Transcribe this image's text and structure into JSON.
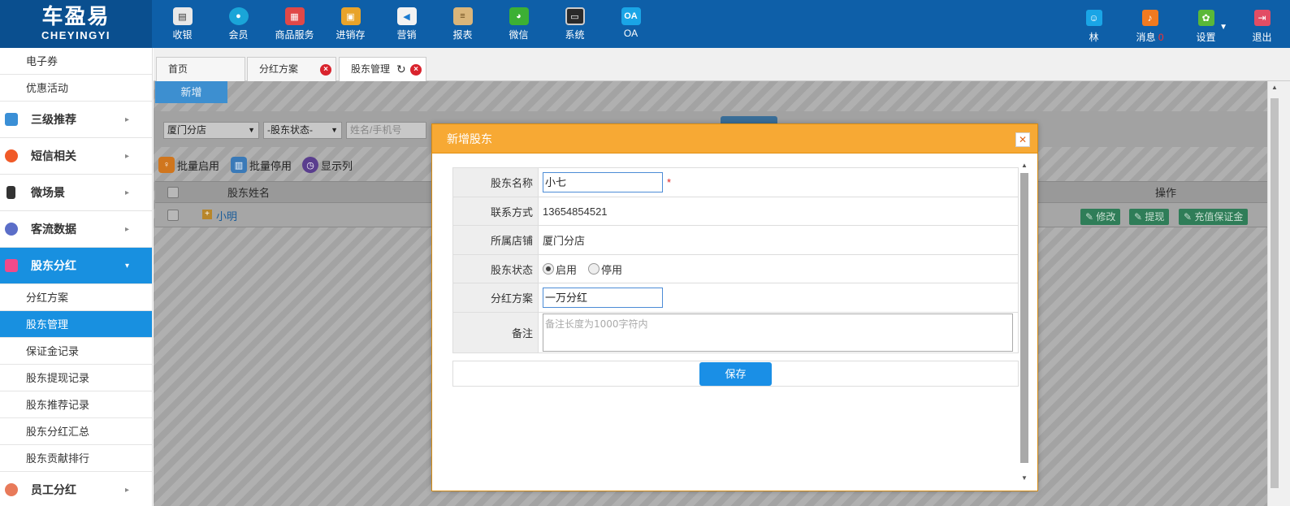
{
  "logo": {
    "cn": "车盈易",
    "en": "CHEYINGYI"
  },
  "nav": [
    {
      "label": "收银",
      "icon": "cash-register-icon",
      "color": "#e8e8e8"
    },
    {
      "label": "会员",
      "icon": "member-icon",
      "color": "#1aa5d8"
    },
    {
      "label": "商品服务",
      "icon": "goods-icon",
      "color": "#e04848"
    },
    {
      "label": "进销存",
      "icon": "inventory-icon",
      "color": "#e8a32a"
    },
    {
      "label": "营销",
      "icon": "megaphone-icon",
      "color": "#f2f2f2"
    },
    {
      "label": "报表",
      "icon": "report-icon",
      "color": "#d9b57a"
    },
    {
      "label": "微信",
      "icon": "wechat-icon",
      "color": "#3cb034"
    },
    {
      "label": "系统",
      "icon": "monitor-icon",
      "color": "#2a2a2a"
    },
    {
      "label": "OA",
      "icon": "oa-icon",
      "color": "#1aa5e6"
    }
  ],
  "right_nav": {
    "user": {
      "label": "林",
      "icon": "user-icon",
      "color": "#1aa5e6"
    },
    "messages": {
      "label": "消息",
      "count": "0",
      "icon": "bell-icon",
      "color": "#f07a20"
    },
    "settings": {
      "label": "设置",
      "icon": "gear-icon",
      "color": "#5ab838"
    },
    "logout": {
      "label": "退出",
      "icon": "logout-icon",
      "color": "#e24d64"
    }
  },
  "sidebar": {
    "top_items": [
      "电子券",
      "优惠活动"
    ],
    "groups": [
      {
        "label": "三级推荐",
        "icon": "layers-icon",
        "color": "#3a8fd6"
      },
      {
        "label": "短信相关",
        "icon": "phone-icon",
        "color": "#f05a28"
      },
      {
        "label": "微场景",
        "icon": "mobile-icon",
        "color": "#333333"
      },
      {
        "label": "客流数据",
        "icon": "wave-icon",
        "color": "#5b6ec8"
      }
    ],
    "active_group": {
      "label": "股东分红",
      "icon": "document-icon",
      "color": "#f04a8a"
    },
    "sub_items": [
      "分红方案",
      "股东管理",
      "保证金记录",
      "股东提现记录",
      "股东推荐记录",
      "股东分红汇总",
      "股东贡献排行"
    ],
    "active_sub": "股东管理",
    "bottom_group": {
      "label": "员工分红",
      "icon": "staff-icon",
      "color": "#e87a5a"
    }
  },
  "tabs": [
    {
      "label": "首页"
    },
    {
      "label": "分红方案"
    },
    {
      "label": "股东管理"
    }
  ],
  "toolbar": {
    "new_label": "新增"
  },
  "filters": {
    "store": "厦门分店",
    "status": "-股东状态-",
    "search_placeholder": "姓名/手机号"
  },
  "actions": {
    "batch_enable": "批量启用",
    "batch_disable": "批量停用",
    "show_columns": "显示列"
  },
  "table": {
    "col_name": "股东姓名",
    "col_ops": "操作",
    "rows": [
      {
        "name": "小明"
      }
    ],
    "row_ops": [
      "修改",
      "提现",
      "充值保证金"
    ]
  },
  "modal": {
    "title": "新增股东",
    "fields": {
      "name_label": "股东名称",
      "name_value": "小七",
      "required_mark": "*",
      "contact_label": "联系方式",
      "contact_value": "13654854521",
      "store_label": "所属店铺",
      "store_value": "厦门分店",
      "status_label": "股东状态",
      "status_on": "启用",
      "status_off": "停用",
      "plan_label": "分红方案",
      "plan_value": "一万分红",
      "remark_label": "备注",
      "remark_placeholder": "备注长度为1000字符内"
    },
    "save_label": "保存"
  },
  "colors": {
    "topbar": "#0e5fa8",
    "accent": "#1890e0",
    "modal_header": "#f7a934",
    "op_button": "#2f7d58"
  }
}
